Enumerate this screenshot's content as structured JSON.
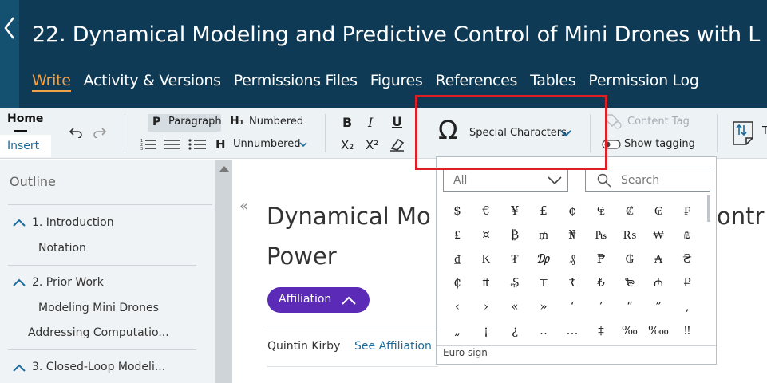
{
  "header": {
    "title": "22. Dynamical Modeling and Predictive Control of Mini Drones with L",
    "nav": [
      "Write",
      "Activity & Versions",
      "Permissions Files",
      "Figures",
      "References",
      "Tables",
      "Permission Log"
    ],
    "active_nav": "Write"
  },
  "toolbar": {
    "tab_home": "Home",
    "tab_insert": "Insert",
    "paragraph_label": "Paragraph",
    "paragraph_icon": "P",
    "numbered_label": "Numbered",
    "numbered_icon": "H₁",
    "unnumbered_label": "Unnumbered",
    "unnumbered_icon": "H",
    "bold": "B",
    "italic": "I",
    "underline": "U",
    "subscript": "X₂",
    "superscript": "X²",
    "special_characters_label": "Special Characters",
    "special_characters_icon": "Ω",
    "content_tag_label": "Content Tag",
    "show_tagging_label": "Show tagging",
    "track_letter": "T",
    "highlight_color": "#e01e26"
  },
  "sidebar": {
    "title": "Outline",
    "items": [
      {
        "label": "1. Introduction"
      },
      {
        "label": "Notation"
      },
      {
        "label": "2. Prior Work"
      },
      {
        "label": "Modeling Mini Drones"
      },
      {
        "label": "Addressing Computatio..."
      },
      {
        "label": "3. Closed-Loop Modeli..."
      }
    ]
  },
  "main": {
    "collapse_icon": "«",
    "title_line1": "Dynamical Mo",
    "title_line1_right": "ontr",
    "title_line2": "Power",
    "affiliation_label": "Affiliation",
    "author_name": "Quintin Kirby",
    "see_affiliation": "See Affiliation"
  },
  "special_characters_popup": {
    "category_select": "All",
    "search_placeholder": "Search",
    "characters": [
      [
        "$",
        "€",
        "¥",
        "£",
        "¢",
        "₠",
        "₡",
        "₢",
        "₣"
      ],
      [
        "₤",
        "¤",
        "₿",
        "₥",
        "₦",
        "₧",
        "₨",
        "₩",
        "₪"
      ],
      [
        "₫",
        "₭",
        "₮",
        "₯",
        "₰",
        "₱",
        "₲",
        "₳",
        "₴"
      ],
      [
        "₵",
        "₶",
        "₷",
        "₸",
        "₹",
        "₺",
        "₻",
        "₼",
        "₽"
      ],
      [
        "‹",
        "›",
        "«",
        "»",
        "‘",
        "’",
        "“",
        "”",
        "‚"
      ],
      [
        "„",
        "¡",
        "¿",
        "‥",
        "…",
        "‡",
        "‰",
        "‱",
        "‼"
      ]
    ],
    "status_text": "Euro sign"
  }
}
